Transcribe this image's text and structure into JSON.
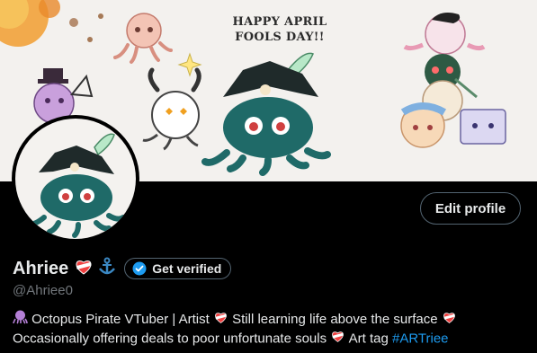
{
  "banner": {
    "title_line1": "HAPPY APRIL",
    "title_line2": "FOOLS DAY!!"
  },
  "profile": {
    "display_name": "Ahriee",
    "handle": "@Ahriee0",
    "edit_profile_label": "Edit profile",
    "get_verified_label": "Get verified"
  },
  "bio": {
    "line1": "Octopus Pirate VTuber | Artist",
    "line1b": "Still learning life above the surface",
    "line2": "Occasionally offering deals to poor unfortunate souls",
    "line2b": "Art tag",
    "hashtag": "#ARTriee"
  },
  "icons": {
    "name_badges": [
      "heart-bandage-icon",
      "anchor-icon"
    ],
    "verify": "verified-badge-icon",
    "bio_lead": "octopus-icon"
  },
  "colors": {
    "background": "#000000",
    "text": "#e7e9ea",
    "muted": "#71767b",
    "link": "#1d9bf0",
    "border": "#536471"
  }
}
